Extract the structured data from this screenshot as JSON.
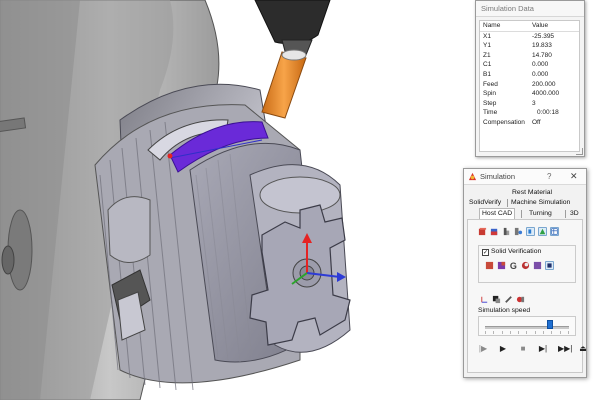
{
  "simulation_data": {
    "title": "Simulation Data",
    "headers": {
      "name": "Name",
      "value": "Value"
    },
    "rows": [
      {
        "name": "X1",
        "value": "-25.395"
      },
      {
        "name": "Y1",
        "value": "19.833"
      },
      {
        "name": "Z1",
        "value": "14.780"
      },
      {
        "name": "C1",
        "value": "0.000"
      },
      {
        "name": "B1",
        "value": "0.000"
      },
      {
        "name": "Feed",
        "value": "200.000"
      },
      {
        "name": "Spin",
        "value": "4000.000"
      },
      {
        "name": "Step",
        "value": "3"
      },
      {
        "name": "Time",
        "value": "0:00:18"
      },
      {
        "name": "Compensation",
        "value": "Off"
      }
    ]
  },
  "simulation_dialog": {
    "title": "Simulation",
    "help": "?",
    "close": "✕",
    "tabs_row1": [
      "Rest Material"
    ],
    "tabs_row2": [
      "SolidVerify",
      "Machine Simulation"
    ],
    "tabs_row3": [
      "Host CAD",
      "Turning",
      "3D"
    ],
    "active_tab": "Host CAD",
    "solid_verification": {
      "label": "Solid Verification",
      "checked": true
    },
    "speed": {
      "label": "Simulation speed",
      "level_percent": 77
    },
    "playback": [
      "|▶",
      "▶",
      "■",
      "▶|",
      "▶▶|",
      "⏏"
    ]
  },
  "colors": {
    "accent": "#1f6fd1",
    "highlight_cut": "#6a2ad8",
    "tool_orange": "#e98a2a"
  }
}
